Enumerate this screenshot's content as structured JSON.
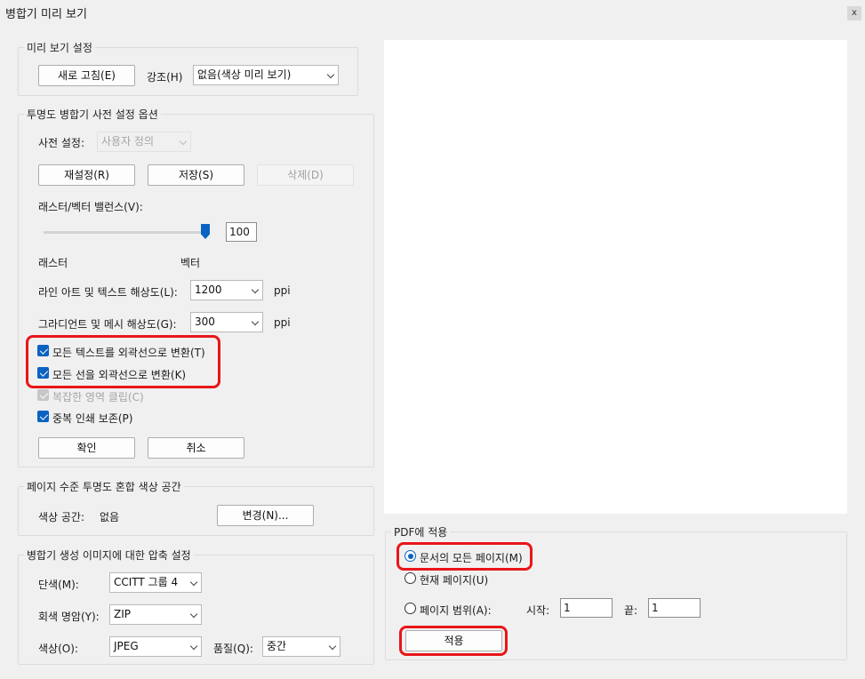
{
  "window": {
    "title": "병합기 미리 보기",
    "close_label": "x"
  },
  "preview_settings": {
    "legend": "미리 보기 설정",
    "refresh_button": "새로 고침(E)",
    "highlight_label": "강조(H)",
    "highlight_value": "없음(색상 미리 보기)"
  },
  "preset_options": {
    "legend": "투명도 병합기 사전 설정 옵션",
    "preset_label": "사전 설정:",
    "preset_value": "사용자 정의",
    "reset_button": "재설정(R)",
    "save_button": "저장(S)",
    "delete_button": "삭제(D)",
    "balance_label": "래스터/벡터 밸런스(V):",
    "balance_value": "100",
    "raster_label": "래스터",
    "vector_label": "벡터",
    "line_art_label": "라인 아트 및 텍스트 해상도(L):",
    "line_art_value": "1200",
    "gradient_label": "그라디언트 및 메시 해상도(G):",
    "gradient_value": "300",
    "ppi_unit": "ppi",
    "convert_text_label": "모든 텍스트를 외곽선으로 변환(T)",
    "convert_strokes_label": "모든 선을 외곽선으로 변환(K)",
    "clip_complex_label": "복잡한 영역 클립(C)",
    "preserve_overprint_label": "중복 인쇄 보존(P)",
    "ok_button": "확인",
    "cancel_button": "취소"
  },
  "color_space": {
    "legend": "페이지 수준 투명도 혼합 색상 공간",
    "label": "색상 공간:",
    "value": "없음",
    "change_button": "변경(N)..."
  },
  "compression": {
    "legend": "병합기 생성 이미지에 대한 압축 설정",
    "mono_label": "단색(M):",
    "mono_value": "CCITT 그룹 4",
    "gray_label": "회색 명암(Y):",
    "gray_value": "ZIP",
    "color_label": "색상(O):",
    "color_value": "JPEG",
    "quality_label": "품질(Q):",
    "quality_value": "중간"
  },
  "apply_to_pdf": {
    "legend": "PDF에 적용",
    "all_pages_label": "문서의 모든 페이지(M)",
    "current_page_label": "현재 페이지(U)",
    "page_range_label": "페이지 범위(A):",
    "start_label": "시작:",
    "start_value": "1",
    "end_label": "끝:",
    "end_value": "1",
    "apply_button": "적용"
  },
  "colors": {
    "accent": "#0a63c2",
    "highlight_box": "#e8161a",
    "background": "#f0f0f0"
  }
}
